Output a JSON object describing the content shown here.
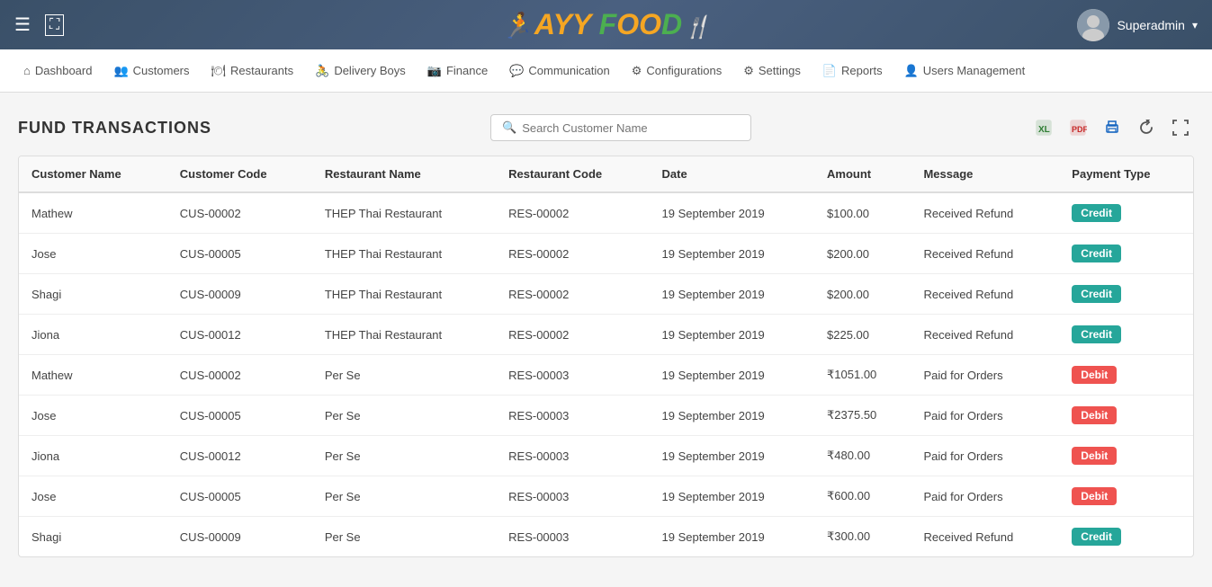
{
  "header": {
    "logo_ayy": "AYY",
    "logo_food": "F",
    "logo_oo": "OO",
    "logo_d": "D",
    "user_label": "Superadmin",
    "dropdown_arrow": "▾"
  },
  "nav": {
    "items": [
      {
        "id": "dashboard",
        "label": "Dashboard",
        "icon": "⌂"
      },
      {
        "id": "customers",
        "label": "Customers",
        "icon": "👥"
      },
      {
        "id": "restaurants",
        "label": "Restaurants",
        "icon": "🍽"
      },
      {
        "id": "delivery-boys",
        "label": "Delivery Boys",
        "icon": "🚴"
      },
      {
        "id": "finance",
        "label": "Finance",
        "icon": "📷"
      },
      {
        "id": "communication",
        "label": "Communication",
        "icon": "💬"
      },
      {
        "id": "configurations",
        "label": "Configurations",
        "icon": "⚙"
      },
      {
        "id": "settings",
        "label": "Settings",
        "icon": "⚙"
      },
      {
        "id": "reports",
        "label": "Reports",
        "icon": "📄"
      },
      {
        "id": "users-management",
        "label": "Users Management",
        "icon": "👤"
      }
    ]
  },
  "page": {
    "title": "FUND TRANSACTIONS",
    "search_placeholder": "Search Customer Name"
  },
  "table": {
    "columns": [
      {
        "id": "customer-name",
        "label": "Customer Name"
      },
      {
        "id": "customer-code",
        "label": "Customer Code"
      },
      {
        "id": "restaurant-name",
        "label": "Restaurant Name"
      },
      {
        "id": "restaurant-code",
        "label": "Restaurant Code"
      },
      {
        "id": "date",
        "label": "Date"
      },
      {
        "id": "amount",
        "label": "Amount"
      },
      {
        "id": "message",
        "label": "Message"
      },
      {
        "id": "payment-type",
        "label": "Payment Type"
      }
    ],
    "rows": [
      {
        "customer_name": "Mathew",
        "customer_code": "CUS-00002",
        "restaurant_name": "THEP Thai Restaurant",
        "restaurant_code": "RES-00002",
        "date": "19 September 2019",
        "amount": "$100.00",
        "message": "Received Refund",
        "payment_type": "Credit",
        "payment_class": "badge-credit"
      },
      {
        "customer_name": "Jose",
        "customer_code": "CUS-00005",
        "restaurant_name": "THEP Thai Restaurant",
        "restaurant_code": "RES-00002",
        "date": "19 September 2019",
        "amount": "$200.00",
        "message": "Received Refund",
        "payment_type": "Credit",
        "payment_class": "badge-credit"
      },
      {
        "customer_name": "Shagi",
        "customer_code": "CUS-00009",
        "restaurant_name": "THEP Thai Restaurant",
        "restaurant_code": "RES-00002",
        "date": "19 September 2019",
        "amount": "$200.00",
        "message": "Received Refund",
        "payment_type": "Credit",
        "payment_class": "badge-credit"
      },
      {
        "customer_name": "Jiona",
        "customer_code": "CUS-00012",
        "restaurant_name": "THEP Thai Restaurant",
        "restaurant_code": "RES-00002",
        "date": "19 September 2019",
        "amount": "$225.00",
        "message": "Received Refund",
        "payment_type": "Credit",
        "payment_class": "badge-credit"
      },
      {
        "customer_name": "Mathew",
        "customer_code": "CUS-00002",
        "restaurant_name": "Per Se",
        "restaurant_code": "RES-00003",
        "date": "19 September 2019",
        "amount": "₹1051.00",
        "message": "Paid for Orders",
        "payment_type": "Debit",
        "payment_class": "badge-debit"
      },
      {
        "customer_name": "Jose",
        "customer_code": "CUS-00005",
        "restaurant_name": "Per Se",
        "restaurant_code": "RES-00003",
        "date": "19 September 2019",
        "amount": "₹2375.50",
        "message": "Paid for Orders",
        "payment_type": "Debit",
        "payment_class": "badge-debit"
      },
      {
        "customer_name": "Jiona",
        "customer_code": "CUS-00012",
        "restaurant_name": "Per Se",
        "restaurant_code": "RES-00003",
        "date": "19 September 2019",
        "amount": "₹480.00",
        "message": "Paid for Orders",
        "payment_type": "Debit",
        "payment_class": "badge-debit"
      },
      {
        "customer_name": "Jose",
        "customer_code": "CUS-00005",
        "restaurant_name": "Per Se",
        "restaurant_code": "RES-00003",
        "date": "19 September 2019",
        "amount": "₹600.00",
        "message": "Paid for Orders",
        "payment_type": "Debit",
        "payment_class": "badge-debit"
      },
      {
        "customer_name": "Shagi",
        "customer_code": "CUS-00009",
        "restaurant_name": "Per Se",
        "restaurant_code": "RES-00003",
        "date": "19 September 2019",
        "amount": "₹300.00",
        "message": "Received Refund",
        "payment_type": "Credit",
        "payment_class": "badge-credit"
      }
    ]
  }
}
